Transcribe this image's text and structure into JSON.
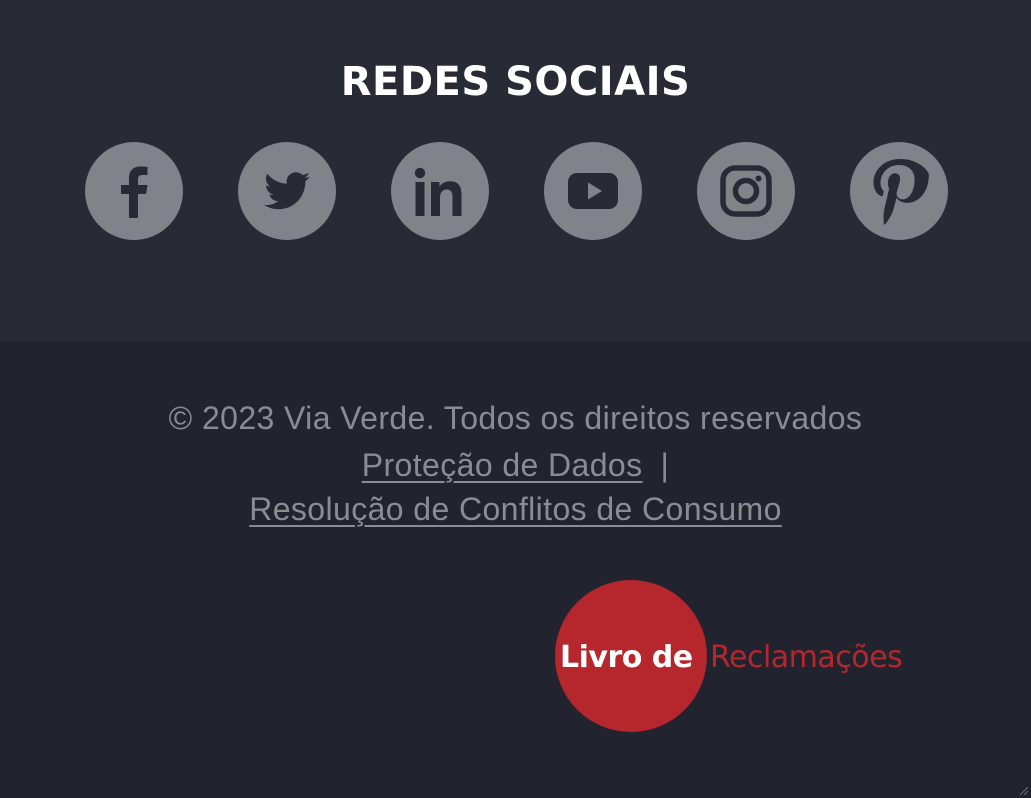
{
  "social": {
    "title": "REDES SOCIAIS",
    "icon_bg_color": "#808389",
    "icon_fg_color": "#282b36",
    "items": [
      {
        "name": "facebook",
        "icon": "facebook-icon"
      },
      {
        "name": "twitter",
        "icon": "twitter-icon"
      },
      {
        "name": "linkedin",
        "icon": "linkedin-icon"
      },
      {
        "name": "youtube",
        "icon": "youtube-icon"
      },
      {
        "name": "instagram",
        "icon": "instagram-icon"
      },
      {
        "name": "pinterest",
        "icon": "pinterest-icon"
      }
    ]
  },
  "legal": {
    "copyright": "© 2023 Via Verde. Todos os direitos reservados",
    "data_protection_label": "Proteção de Dados",
    "separator": "|",
    "consumer_disputes_label": "Resolução de Conflitos de Consumo"
  },
  "complaints_book": {
    "label_part1": "Livro de",
    "label_part2": "Reclamações",
    "brand_color": "#b5262d"
  },
  "colors": {
    "top_background": "#282b36",
    "bottom_background": "#21242f",
    "muted_text": "#8a8c93",
    "title_text": "#ffffff"
  }
}
